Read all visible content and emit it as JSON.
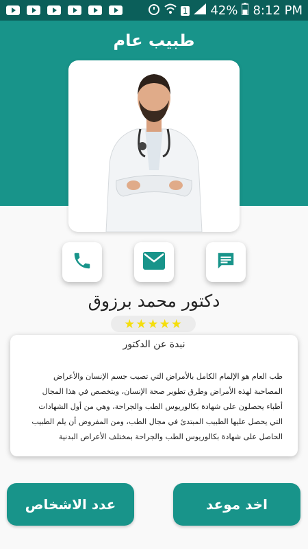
{
  "status_bar": {
    "battery_percent": "42%",
    "time": "8:12 PM",
    "sim_label": "1"
  },
  "header": {
    "title": "طبيب عام"
  },
  "doctor": {
    "name": "دكتور محمد برزوق",
    "rating_stars": "★★★★★",
    "rating_value": 5,
    "rating_max": 5
  },
  "actions": [
    {
      "icon": "message-icon"
    },
    {
      "icon": "email-icon"
    },
    {
      "icon": "phone-icon"
    }
  ],
  "bio": {
    "title": "نبدة عن الدكتور",
    "lines": [
      "طب العام هو الإلمام الكامل بالأمراض التي تصيب جسم الإنسان والأعراض",
      "المصاحبة لهذه الأمراض وطرق تطوير صحة الإنسان، ويتخصص في هذا المجال",
      "أطباء يحصلون على شهادة بكالوريوس الطب والجراحة، وهي من أول الشهادات",
      "التي يحصل عليها الطبيب المبتدئ في مجال الطب، ومن المفروض أن يلم الطبيب",
      "الحاصل على شهادة بكالوريوس الطب والجراحة بمختلف الأعراض البدنية"
    ]
  },
  "buttons": {
    "book": "اخد موعد",
    "people_count": "عدد الاشخاص"
  },
  "colors": {
    "primary": "#18948a",
    "status_bar": "#0b5f5a",
    "star": "#f5de0b"
  }
}
